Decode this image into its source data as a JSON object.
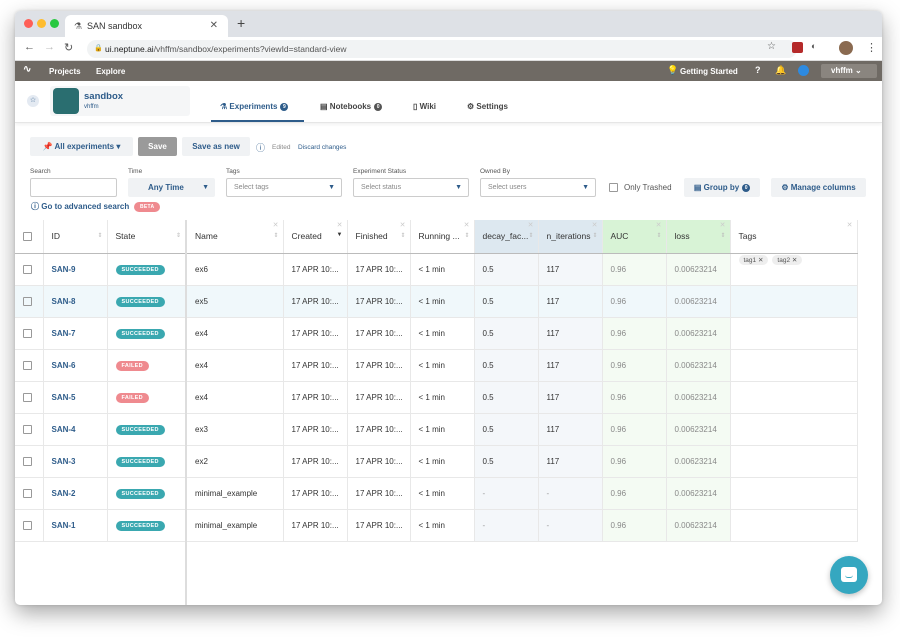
{
  "browser": {
    "tab_title": "SAN sandbox",
    "url_host": "ui.neptune.ai",
    "url_path": "/vhffm/sandbox/experiments?viewId=standard-view",
    "extension_badge": "6"
  },
  "topnav": {
    "projects": "Projects",
    "explore": "Explore",
    "getting_started": "Getting Started",
    "user": "vhffm"
  },
  "project": {
    "name": "sandbox",
    "owner": "vhffm",
    "tabs": [
      {
        "label": "Experiments",
        "badge": "9"
      },
      {
        "label": "Notebooks",
        "badge": "0"
      },
      {
        "label": "Wiki"
      },
      {
        "label": "Settings"
      }
    ]
  },
  "toolbar": {
    "view": "All experiments",
    "save": "Save",
    "save_as_new": "Save as new",
    "edited": "Edited",
    "discard": "Discard changes"
  },
  "filters": {
    "search_label": "Search",
    "search_value": "",
    "time_label": "Time",
    "time_value": "Any Time",
    "tags_label": "Tags",
    "tags_placeholder": "Select tags",
    "status_label": "Experiment Status",
    "status_placeholder": "Select status",
    "owner_label": "Owned By",
    "owner_placeholder": "Select users",
    "only_trashed": "Only Trashed",
    "group_by": "Group by",
    "group_by_count": "0",
    "manage_columns": "Manage columns",
    "advanced_search": "Go to advanced search",
    "beta": "BETA"
  },
  "table": {
    "columns": [
      "ID",
      "State",
      "Name",
      "Created",
      "Finished",
      "Running ...",
      "decay_fac...",
      "n_iterations",
      "AUC",
      "loss",
      "Tags"
    ],
    "rows": [
      {
        "id": "SAN-9",
        "state": "SUCCEEDED",
        "name": "ex6",
        "created": "17 APR 10:...",
        "finished": "17 APR 10:...",
        "running": "< 1 min",
        "decay": "0.5",
        "iters": "117",
        "auc": "0.96",
        "loss": "0.00623214",
        "tags": [
          "tag1",
          "tag2"
        ]
      },
      {
        "id": "SAN-8",
        "state": "SUCCEEDED",
        "name": "ex5",
        "created": "17 APR 10:...",
        "finished": "17 APR 10:...",
        "running": "< 1 min",
        "decay": "0.5",
        "iters": "117",
        "auc": "0.96",
        "loss": "0.00623214",
        "tags": []
      },
      {
        "id": "SAN-7",
        "state": "SUCCEEDED",
        "name": "ex4",
        "created": "17 APR 10:...",
        "finished": "17 APR 10:...",
        "running": "< 1 min",
        "decay": "0.5",
        "iters": "117",
        "auc": "0.96",
        "loss": "0.00623214",
        "tags": []
      },
      {
        "id": "SAN-6",
        "state": "FAILED",
        "name": "ex4",
        "created": "17 APR 10:...",
        "finished": "17 APR 10:...",
        "running": "< 1 min",
        "decay": "0.5",
        "iters": "117",
        "auc": "0.96",
        "loss": "0.00623214",
        "tags": []
      },
      {
        "id": "SAN-5",
        "state": "FAILED",
        "name": "ex4",
        "created": "17 APR 10:...",
        "finished": "17 APR 10:...",
        "running": "< 1 min",
        "decay": "0.5",
        "iters": "117",
        "auc": "0.96",
        "loss": "0.00623214",
        "tags": []
      },
      {
        "id": "SAN-4",
        "state": "SUCCEEDED",
        "name": "ex3",
        "created": "17 APR 10:...",
        "finished": "17 APR 10:...",
        "running": "< 1 min",
        "decay": "0.5",
        "iters": "117",
        "auc": "0.96",
        "loss": "0.00623214",
        "tags": []
      },
      {
        "id": "SAN-3",
        "state": "SUCCEEDED",
        "name": "ex2",
        "created": "17 APR 10:...",
        "finished": "17 APR 10:...",
        "running": "< 1 min",
        "decay": "0.5",
        "iters": "117",
        "auc": "0.96",
        "loss": "0.00623214",
        "tags": []
      },
      {
        "id": "SAN-2",
        "state": "SUCCEEDED",
        "name": "minimal_example",
        "created": "17 APR 10:...",
        "finished": "17 APR 10:...",
        "running": "< 1 min",
        "decay": "-",
        "iters": "-",
        "auc": "0.96",
        "loss": "0.00623214",
        "tags": []
      },
      {
        "id": "SAN-1",
        "state": "SUCCEEDED",
        "name": "minimal_example",
        "created": "17 APR 10:...",
        "finished": "17 APR 10:...",
        "running": "< 1 min",
        "decay": "-",
        "iters": "-",
        "auc": "0.96",
        "loss": "0.00623214",
        "tags": []
      }
    ]
  },
  "colors": {
    "accent": "#2e5c8a",
    "succeeded": "#3aa8b0",
    "failed": "#ef8a8f",
    "topnav": "#6f6a64",
    "chat": "#35a7c0"
  }
}
